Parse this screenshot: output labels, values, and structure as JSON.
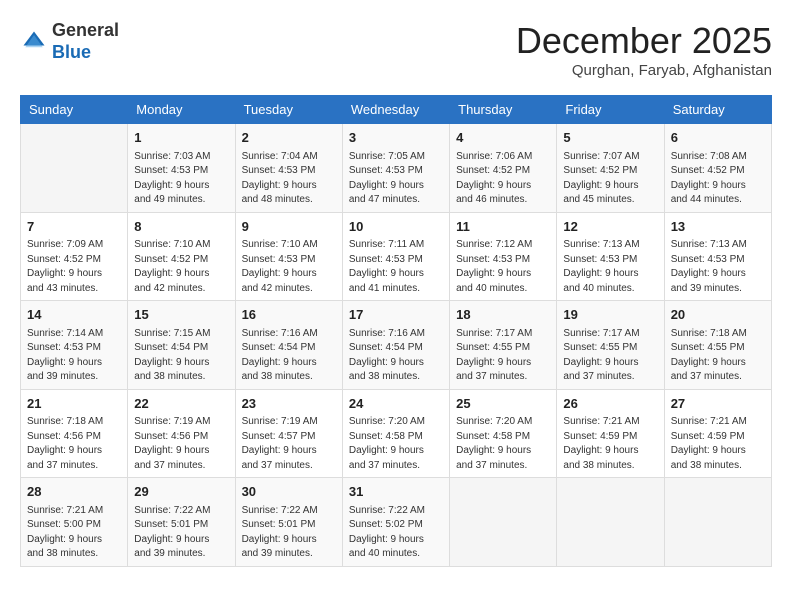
{
  "logo": {
    "general": "General",
    "blue": "Blue"
  },
  "header": {
    "month": "December 2025",
    "location": "Qurghan, Faryab, Afghanistan"
  },
  "days": [
    "Sunday",
    "Monday",
    "Tuesday",
    "Wednesday",
    "Thursday",
    "Friday",
    "Saturday"
  ],
  "weeks": [
    [
      {
        "day": "",
        "content": ""
      },
      {
        "day": "1",
        "content": "Sunrise: 7:03 AM\nSunset: 4:53 PM\nDaylight: 9 hours\nand 49 minutes."
      },
      {
        "day": "2",
        "content": "Sunrise: 7:04 AM\nSunset: 4:53 PM\nDaylight: 9 hours\nand 48 minutes."
      },
      {
        "day": "3",
        "content": "Sunrise: 7:05 AM\nSunset: 4:53 PM\nDaylight: 9 hours\nand 47 minutes."
      },
      {
        "day": "4",
        "content": "Sunrise: 7:06 AM\nSunset: 4:52 PM\nDaylight: 9 hours\nand 46 minutes."
      },
      {
        "day": "5",
        "content": "Sunrise: 7:07 AM\nSunset: 4:52 PM\nDaylight: 9 hours\nand 45 minutes."
      },
      {
        "day": "6",
        "content": "Sunrise: 7:08 AM\nSunset: 4:52 PM\nDaylight: 9 hours\nand 44 minutes."
      }
    ],
    [
      {
        "day": "7",
        "content": "Sunrise: 7:09 AM\nSunset: 4:52 PM\nDaylight: 9 hours\nand 43 minutes."
      },
      {
        "day": "8",
        "content": "Sunrise: 7:10 AM\nSunset: 4:52 PM\nDaylight: 9 hours\nand 42 minutes."
      },
      {
        "day": "9",
        "content": "Sunrise: 7:10 AM\nSunset: 4:53 PM\nDaylight: 9 hours\nand 42 minutes."
      },
      {
        "day": "10",
        "content": "Sunrise: 7:11 AM\nSunset: 4:53 PM\nDaylight: 9 hours\nand 41 minutes."
      },
      {
        "day": "11",
        "content": "Sunrise: 7:12 AM\nSunset: 4:53 PM\nDaylight: 9 hours\nand 40 minutes."
      },
      {
        "day": "12",
        "content": "Sunrise: 7:13 AM\nSunset: 4:53 PM\nDaylight: 9 hours\nand 40 minutes."
      },
      {
        "day": "13",
        "content": "Sunrise: 7:13 AM\nSunset: 4:53 PM\nDaylight: 9 hours\nand 39 minutes."
      }
    ],
    [
      {
        "day": "14",
        "content": "Sunrise: 7:14 AM\nSunset: 4:53 PM\nDaylight: 9 hours\nand 39 minutes."
      },
      {
        "day": "15",
        "content": "Sunrise: 7:15 AM\nSunset: 4:54 PM\nDaylight: 9 hours\nand 38 minutes."
      },
      {
        "day": "16",
        "content": "Sunrise: 7:16 AM\nSunset: 4:54 PM\nDaylight: 9 hours\nand 38 minutes."
      },
      {
        "day": "17",
        "content": "Sunrise: 7:16 AM\nSunset: 4:54 PM\nDaylight: 9 hours\nand 38 minutes."
      },
      {
        "day": "18",
        "content": "Sunrise: 7:17 AM\nSunset: 4:55 PM\nDaylight: 9 hours\nand 37 minutes."
      },
      {
        "day": "19",
        "content": "Sunrise: 7:17 AM\nSunset: 4:55 PM\nDaylight: 9 hours\nand 37 minutes."
      },
      {
        "day": "20",
        "content": "Sunrise: 7:18 AM\nSunset: 4:55 PM\nDaylight: 9 hours\nand 37 minutes."
      }
    ],
    [
      {
        "day": "21",
        "content": "Sunrise: 7:18 AM\nSunset: 4:56 PM\nDaylight: 9 hours\nand 37 minutes."
      },
      {
        "day": "22",
        "content": "Sunrise: 7:19 AM\nSunset: 4:56 PM\nDaylight: 9 hours\nand 37 minutes."
      },
      {
        "day": "23",
        "content": "Sunrise: 7:19 AM\nSunset: 4:57 PM\nDaylight: 9 hours\nand 37 minutes."
      },
      {
        "day": "24",
        "content": "Sunrise: 7:20 AM\nSunset: 4:58 PM\nDaylight: 9 hours\nand 37 minutes."
      },
      {
        "day": "25",
        "content": "Sunrise: 7:20 AM\nSunset: 4:58 PM\nDaylight: 9 hours\nand 37 minutes."
      },
      {
        "day": "26",
        "content": "Sunrise: 7:21 AM\nSunset: 4:59 PM\nDaylight: 9 hours\nand 38 minutes."
      },
      {
        "day": "27",
        "content": "Sunrise: 7:21 AM\nSunset: 4:59 PM\nDaylight: 9 hours\nand 38 minutes."
      }
    ],
    [
      {
        "day": "28",
        "content": "Sunrise: 7:21 AM\nSunset: 5:00 PM\nDaylight: 9 hours\nand 38 minutes."
      },
      {
        "day": "29",
        "content": "Sunrise: 7:22 AM\nSunset: 5:01 PM\nDaylight: 9 hours\nand 39 minutes."
      },
      {
        "day": "30",
        "content": "Sunrise: 7:22 AM\nSunset: 5:01 PM\nDaylight: 9 hours\nand 39 minutes."
      },
      {
        "day": "31",
        "content": "Sunrise: 7:22 AM\nSunset: 5:02 PM\nDaylight: 9 hours\nand 40 minutes."
      },
      {
        "day": "",
        "content": ""
      },
      {
        "day": "",
        "content": ""
      },
      {
        "day": "",
        "content": ""
      }
    ]
  ]
}
